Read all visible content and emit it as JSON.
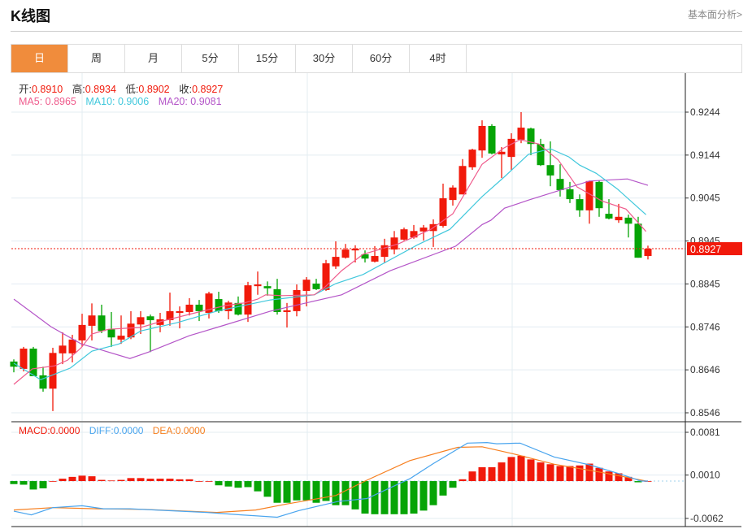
{
  "header": {
    "title": "K线图",
    "link": "基本面分析>"
  },
  "tabs": [
    {
      "label": "日",
      "active": true
    },
    {
      "label": "周"
    },
    {
      "label": "月"
    },
    {
      "label": "5分"
    },
    {
      "label": "15分"
    },
    {
      "label": "30分"
    },
    {
      "label": "60分"
    },
    {
      "label": "4时"
    }
  ],
  "ohlc_info": {
    "open_label": "开:",
    "open": "0.8910",
    "high_label": "高:",
    "high": "0.8934",
    "low_label": "低:",
    "low": "0.8902",
    "close_label": "收:",
    "close": "0.8927"
  },
  "ma_info": {
    "ma5": "MA5: 0.8965",
    "ma10": "MA10: 0.9006",
    "ma20": "MA20: 0.9081"
  },
  "macd_info": {
    "macd": "MACD:0.0000",
    "diff": "DIFF:0.0000",
    "dea": "DEA:0.0000"
  },
  "colors": {
    "up": "#f11a0b",
    "down": "#06a406",
    "ma5": "#ef5b8c",
    "ma10": "#41c8dc",
    "ma20": "#b455c8",
    "diff": "#4aa5ee",
    "dea": "#f77f1f",
    "accent": "#f08c3c"
  },
  "chart_data": [
    {
      "type": "candlestick",
      "price_ticks": [
        "0.9244",
        "0.9144",
        "0.9045",
        "0.8945",
        "0.8845",
        "0.8746",
        "0.8646",
        "0.8546"
      ],
      "ylim": [
        0.8546,
        0.9244
      ],
      "last_price": "0.8927",
      "candles": [
        [
          0.8665,
          0.867,
          0.864,
          0.8653
        ],
        [
          0.8648,
          0.8699,
          0.8642,
          0.8695
        ],
        [
          0.8695,
          0.8699,
          0.8631,
          0.8631
        ],
        [
          0.8633,
          0.8653,
          0.8595,
          0.8602
        ],
        [
          0.8602,
          0.8697,
          0.855,
          0.8685
        ],
        [
          0.8684,
          0.8733,
          0.8659,
          0.8702
        ],
        [
          0.8684,
          0.8727,
          0.8663,
          0.8716
        ],
        [
          0.8714,
          0.8776,
          0.8699,
          0.875
        ],
        [
          0.8748,
          0.88,
          0.8714,
          0.8772
        ],
        [
          0.8772,
          0.8797,
          0.8731,
          0.8736
        ],
        [
          0.874,
          0.878,
          0.8699,
          0.8721
        ],
        [
          0.8716,
          0.8772,
          0.8706,
          0.8725
        ],
        [
          0.8721,
          0.8782,
          0.8717,
          0.8753
        ],
        [
          0.8751,
          0.8782,
          0.8729,
          0.8768
        ],
        [
          0.877,
          0.8774,
          0.8687,
          0.8761
        ],
        [
          0.875,
          0.8778,
          0.8733,
          0.8763
        ],
        [
          0.8761,
          0.8825,
          0.8748,
          0.8782
        ],
        [
          0.8778,
          0.8793,
          0.8742,
          0.8782
        ],
        [
          0.878,
          0.8812,
          0.8772,
          0.8797
        ],
        [
          0.8797,
          0.8808,
          0.8759,
          0.8782
        ],
        [
          0.8778,
          0.8827,
          0.8765,
          0.8823
        ],
        [
          0.881,
          0.8827,
          0.8778,
          0.8782
        ],
        [
          0.8782,
          0.8806,
          0.8763,
          0.8802
        ],
        [
          0.8801,
          0.8816,
          0.8772,
          0.8774
        ],
        [
          0.8774,
          0.885,
          0.8757,
          0.8842
        ],
        [
          0.884,
          0.8874,
          0.882,
          0.8844
        ],
        [
          0.884,
          0.8851,
          0.8818,
          0.8835
        ],
        [
          0.8833,
          0.8857,
          0.8774,
          0.878
        ],
        [
          0.878,
          0.8801,
          0.8744,
          0.8784
        ],
        [
          0.8782,
          0.8844,
          0.877,
          0.8831
        ],
        [
          0.8829,
          0.8861,
          0.8793,
          0.8855
        ],
        [
          0.8846,
          0.8857,
          0.8831,
          0.8833
        ],
        [
          0.8831,
          0.8901,
          0.8829,
          0.8893
        ],
        [
          0.8886,
          0.8944,
          0.888,
          0.8908
        ],
        [
          0.8906,
          0.8938,
          0.8904,
          0.8925
        ],
        [
          0.8923,
          0.8935,
          0.8895,
          0.8927
        ],
        [
          0.8914,
          0.8923,
          0.8895,
          0.8904
        ],
        [
          0.8897,
          0.8933,
          0.8895,
          0.891
        ],
        [
          0.8908,
          0.895,
          0.8895,
          0.8935
        ],
        [
          0.8925,
          0.8968,
          0.8914,
          0.8953
        ],
        [
          0.8948,
          0.8976,
          0.8946,
          0.8972
        ],
        [
          0.8953,
          0.8982,
          0.895,
          0.8968
        ],
        [
          0.8967,
          0.8982,
          0.8946,
          0.8976
        ],
        [
          0.8968,
          0.8995,
          0.8931,
          0.8984
        ],
        [
          0.898,
          0.9078,
          0.8976,
          0.9044
        ],
        [
          0.904,
          0.9074,
          0.9027,
          0.9069
        ],
        [
          0.9053,
          0.9135,
          0.9053,
          0.9119
        ],
        [
          0.9116,
          0.9159,
          0.911,
          0.9157
        ],
        [
          0.9155,
          0.9225,
          0.9138,
          0.9212
        ],
        [
          0.9212,
          0.9216,
          0.9146,
          0.9148
        ],
        [
          0.9146,
          0.9163,
          0.9091,
          0.9152
        ],
        [
          0.914,
          0.9195,
          0.911,
          0.9182
        ],
        [
          0.918,
          0.9244,
          0.9172,
          0.9208
        ],
        [
          0.9206,
          0.9208,
          0.9144,
          0.917
        ],
        [
          0.917,
          0.9182,
          0.9119,
          0.9121
        ],
        [
          0.9121,
          0.9176,
          0.9072,
          0.9097
        ],
        [
          0.9089,
          0.9123,
          0.9048,
          0.9063
        ],
        [
          0.9065,
          0.9082,
          0.9033,
          0.9042
        ],
        [
          0.9042,
          0.9053,
          0.9001,
          0.9016
        ],
        [
          0.9016,
          0.9085,
          0.8985,
          0.9084
        ],
        [
          0.9082,
          0.9085,
          0.9001,
          0.9021
        ],
        [
          0.9008,
          0.9042,
          0.8995,
          0.8997
        ],
        [
          0.8993,
          0.9031,
          0.8987,
          0.9001
        ],
        [
          0.8999,
          0.9006,
          0.8953,
          0.8985
        ],
        [
          0.8985,
          0.9001,
          0.8906,
          0.8906
        ],
        [
          0.891,
          0.8934,
          0.8902,
          0.8927
        ]
      ],
      "ma5": {
        "idx": [
          1,
          2.9,
          5.2,
          6.5,
          7.9,
          9,
          10.7,
          14,
          16.25,
          19.6,
          22.7,
          24.6,
          26,
          26.8,
          28.5,
          31.8,
          32.9,
          34.6,
          36.8,
          40.4,
          43.75,
          46,
          49,
          51.25,
          52.9,
          54.8,
          56.8,
          58.75,
          61.25,
          63.75,
          65.8
        ],
        "val": [
          0.8612,
          0.8648,
          0.8655,
          0.8668,
          0.8697,
          0.8729,
          0.874,
          0.8744,
          0.8759,
          0.8778,
          0.8795,
          0.8801,
          0.881,
          0.882,
          0.8818,
          0.882,
          0.8838,
          0.8876,
          0.8914,
          0.8938,
          0.8972,
          0.9008,
          0.9123,
          0.9161,
          0.918,
          0.917,
          0.9133,
          0.907,
          0.9038,
          0.9019,
          0.8967
        ]
      },
      "ma10": {
        "idx": [
          1,
          3.75,
          6.8,
          9,
          11.8,
          14,
          17.7,
          21.8,
          27.3,
          31.8,
          34,
          36.8,
          42.3,
          45.7,
          49,
          51.25,
          53.75,
          56,
          57.9,
          59,
          60.7,
          62.9,
          65.8
        ],
        "val": [
          0.8661,
          0.8623,
          0.865,
          0.8689,
          0.8706,
          0.8736,
          0.8755,
          0.8782,
          0.8808,
          0.882,
          0.8846,
          0.8867,
          0.8935,
          0.8972,
          0.9048,
          0.9093,
          0.9146,
          0.9159,
          0.914,
          0.9121,
          0.9102,
          0.9065,
          0.9006
        ]
      },
      "ma20": {
        "idx": [
          1,
          4.8,
          7.9,
          12.9,
          14.8,
          19,
          21.8,
          27.3,
          34.6,
          39.6,
          46.3,
          49,
          49.9,
          51.3,
          53.8,
          60,
          63.9,
          66
        ],
        "val": [
          0.881,
          0.8746,
          0.8706,
          0.8672,
          0.8687,
          0.8725,
          0.8744,
          0.8782,
          0.882,
          0.8876,
          0.8933,
          0.8983,
          0.8993,
          0.9021,
          0.904,
          0.9084,
          0.9089,
          0.9074
        ]
      }
    },
    {
      "type": "macd",
      "ticks": [
        "0.0081",
        "0.0010",
        "-0.0062"
      ],
      "ylim": [
        -0.0062,
        0.0081
      ],
      "histogram": [
        -0.0005,
        -0.0006,
        -0.0014,
        -0.0012,
        0,
        0.0004,
        0.0007,
        0.0009,
        0.0008,
        0.0002,
        0.0001,
        0.0002,
        0.0005,
        0.0005,
        0.0004,
        0.0004,
        0.0004,
        0.0003,
        0.0003,
        0,
        0,
        -0.0007,
        -0.0009,
        -0.0011,
        -0.001,
        -0.0017,
        -0.0026,
        -0.0036,
        -0.0036,
        -0.0032,
        -0.0032,
        -0.0036,
        -0.0033,
        -0.004,
        -0.004,
        -0.0047,
        -0.0054,
        -0.0055,
        -0.0055,
        -0.0055,
        -0.0055,
        -0.0054,
        -0.0049,
        -0.004,
        -0.0024,
        -0.0011,
        0.0003,
        0.0016,
        0.0023,
        0.0023,
        0.0031,
        0.004,
        0.0042,
        0.0036,
        0.0031,
        0.0028,
        0.0025,
        0.0025,
        0.0026,
        0.0029,
        0.0022,
        0.0016,
        0.0013,
        0.0007,
        -0.0002,
        0
      ],
      "diff": {
        "idx": [
          1,
          2.8,
          5,
          8,
          10.2,
          12.9,
          20.8,
          24.3,
          28,
          30.2,
          34.2,
          37.2,
          41.6,
          44,
          47.5,
          49.5,
          50.5,
          52.9,
          56.4,
          60,
          63.3,
          65.3,
          66
        ],
        "val": [
          -0.005,
          -0.0056,
          -0.0044,
          -0.0041,
          -0.0046,
          -0.0046,
          -0.0052,
          -0.0056,
          -0.006,
          -0.0049,
          -0.0034,
          -0.0029,
          0.0004,
          0.0029,
          0.0063,
          0.0064,
          0.0062,
          0.0063,
          0.004,
          0.0027,
          0.0011,
          0,
          0
        ]
      },
      "dea": {
        "idx": [
          1,
          5,
          9.5,
          14.4,
          21.8,
          25.8,
          29,
          34,
          37,
          41.6,
          46.5,
          49,
          52,
          56.4,
          61.4,
          65.8,
          66
        ],
        "val": [
          -0.0048,
          -0.0044,
          -0.0046,
          -0.0047,
          -0.0052,
          -0.0048,
          -0.0038,
          -0.0024,
          0,
          0.0034,
          0.0056,
          0.0057,
          0.0046,
          0.0028,
          0.0014,
          0,
          0
        ]
      }
    }
  ]
}
